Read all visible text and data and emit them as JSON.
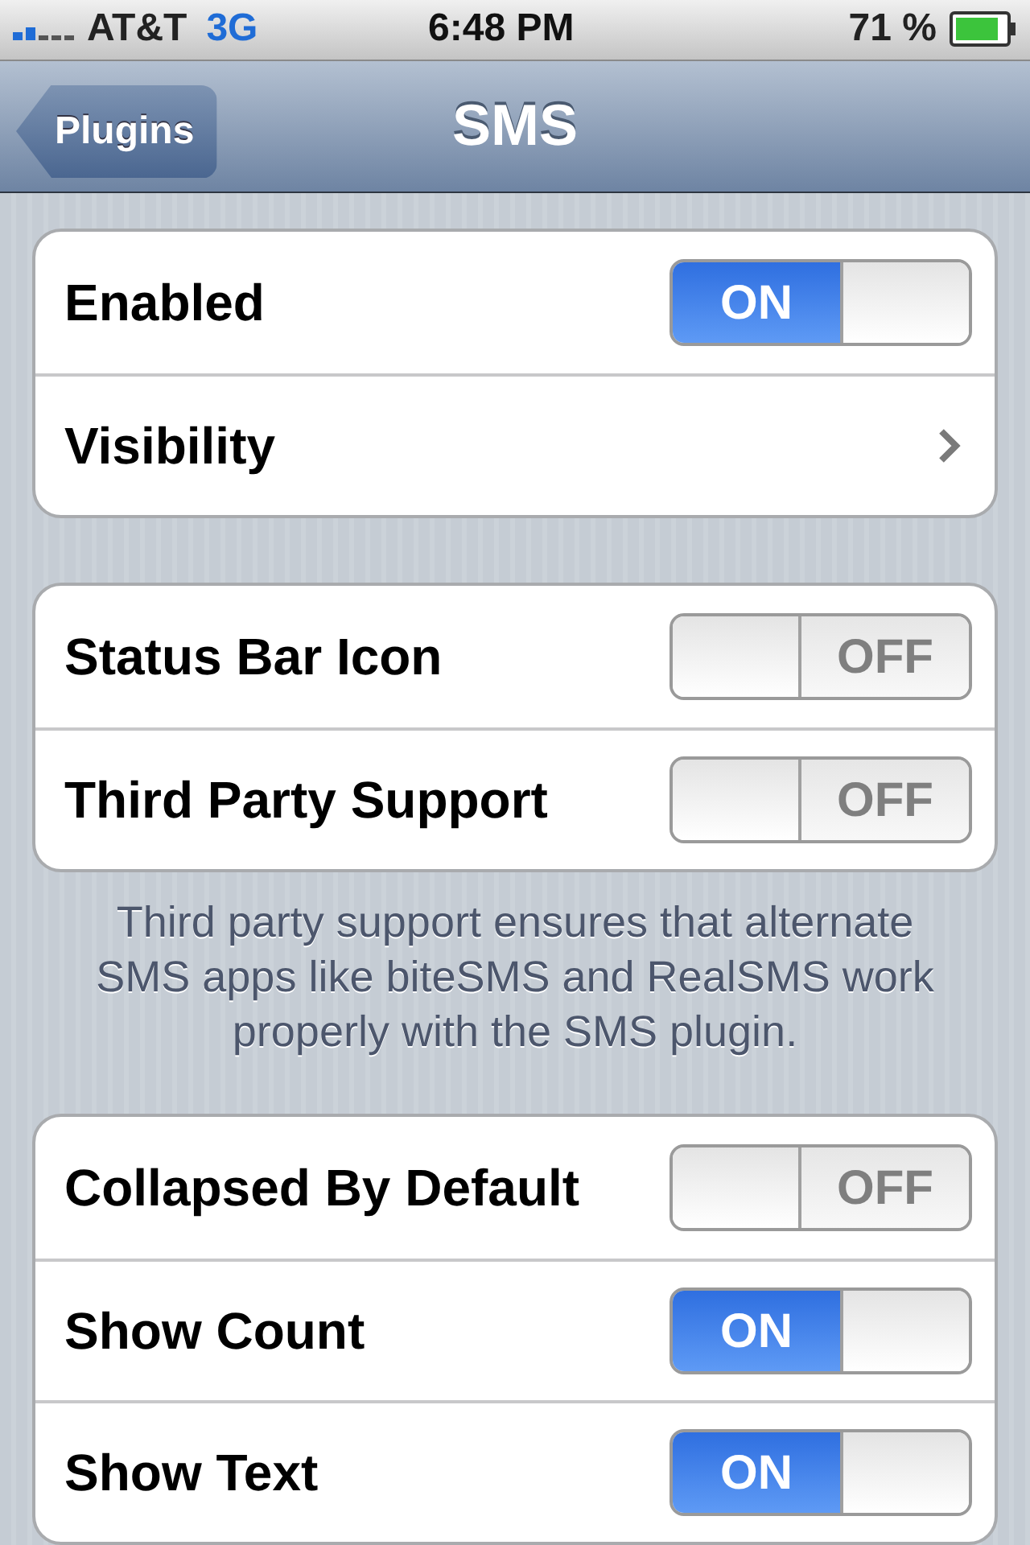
{
  "status_bar": {
    "carrier": "AT&T",
    "network": "3G",
    "time": "6:48 PM",
    "battery": "71 %"
  },
  "nav_bar": {
    "back": "Plugins",
    "title": "SMS"
  },
  "groups": [
    {
      "rows": [
        {
          "label": "Enabled",
          "kind": "switch",
          "on": true,
          "switch_text": "ON"
        },
        {
          "label": "Visibility",
          "kind": "disclosure"
        }
      ]
    },
    {
      "rows": [
        {
          "label": "Status Bar Icon",
          "kind": "switch",
          "on": false,
          "switch_text": "OFF"
        },
        {
          "label": "Third Party Support",
          "kind": "switch",
          "on": false,
          "switch_text": "OFF"
        }
      ],
      "footer": "Third party support ensures that alternate SMS apps like biteSMS and RealSMS work properly with the SMS plugin."
    },
    {
      "rows": [
        {
          "label": "Collapsed By Default",
          "kind": "switch",
          "on": false,
          "switch_text": "OFF"
        },
        {
          "label": "Show Count",
          "kind": "switch",
          "on": true,
          "switch_text": "ON"
        },
        {
          "label": "Show Text",
          "kind": "switch",
          "on": true,
          "switch_text": "ON"
        }
      ]
    }
  ]
}
